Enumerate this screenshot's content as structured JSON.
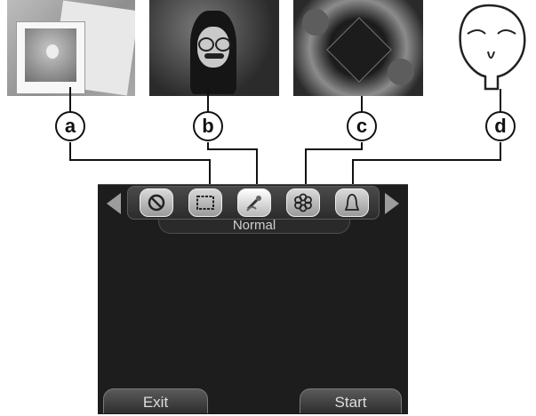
{
  "callouts": [
    "a",
    "b",
    "c",
    "d"
  ],
  "effect_bar": {
    "selected_effect": "Normal",
    "items": [
      {
        "icon": "no-effect-icon"
      },
      {
        "icon": "photo-frame-icon"
      },
      {
        "icon": "funny-face-icon",
        "selected": true
      },
      {
        "icon": "kaleidoscope-icon"
      },
      {
        "icon": "face-distortion-icon"
      }
    ]
  },
  "buttons": {
    "exit": "Exit",
    "start": "Start"
  },
  "colors": {
    "screen": "#1d1d1d",
    "label": "#cfcfcf"
  }
}
